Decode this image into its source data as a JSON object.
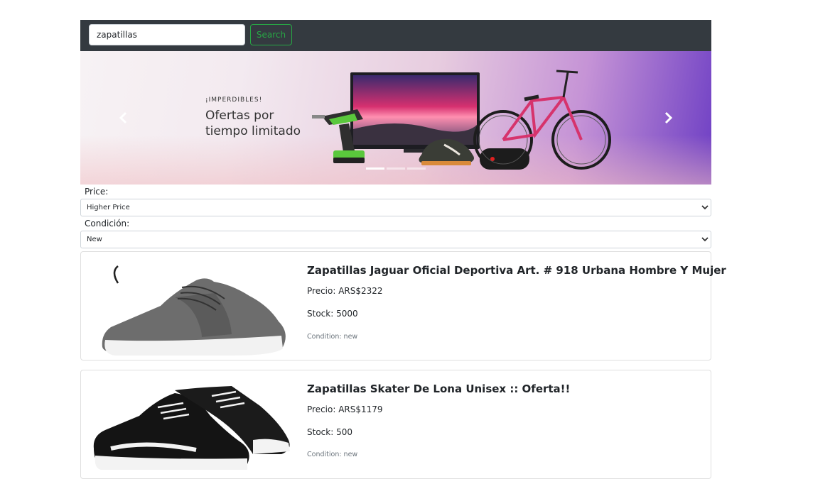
{
  "search": {
    "value": "zapatillas",
    "button_label": "Search"
  },
  "banner": {
    "kicker": "¡IMPERDIBLES!",
    "title_line1": "Ofertas por",
    "title_line2": "tiempo limitado",
    "prev_label": "Previous",
    "next_label": "Next",
    "slide_count": 3,
    "active_slide": 0
  },
  "filters": {
    "price": {
      "label": "Price:",
      "selected": "Higher Price"
    },
    "condition": {
      "label": "Condición:",
      "selected": "New"
    }
  },
  "products": [
    {
      "title": "Zapatillas Jaguar Oficial Deportiva Art. # 918 Urbana Hombre Y Mujer",
      "price": "Precio: ARS$2322",
      "stock": "Stock: 5000",
      "condition": "Condition: new"
    },
    {
      "title": "Zapatillas Skater De Lona Unisex :: Oferta!!",
      "price": "Precio: ARS$1179",
      "stock": "Stock: 500",
      "condition": "Condition: new"
    }
  ],
  "colors": {
    "navbar": "#343a40",
    "search_button": "#28a745",
    "muted_text": "#6c757d"
  },
  "icons": [
    "chevron-left-icon",
    "chevron-right-icon",
    "chevron-down-icon"
  ]
}
